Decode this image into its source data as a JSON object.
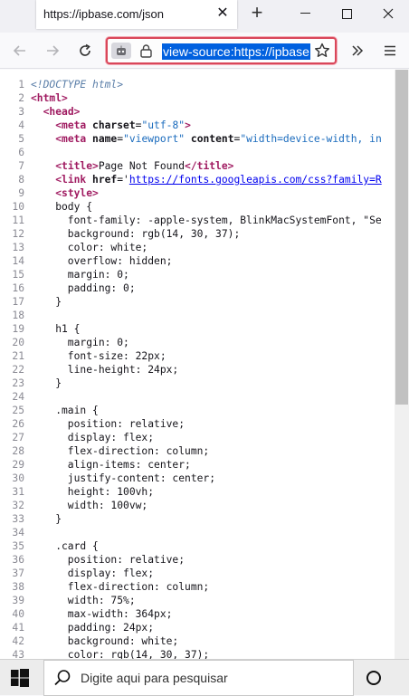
{
  "tab": {
    "title": "https://ipbase.com/json"
  },
  "urlbar": {
    "text": "view-source:https://ipbase."
  },
  "source_lines": [
    {
      "n": "1",
      "segs": [
        [
          "doctype",
          "<!DOCTYPE html>"
        ]
      ]
    },
    {
      "n": "2",
      "segs": [
        [
          "tag",
          "<html>"
        ]
      ]
    },
    {
      "n": "3",
      "segs": [
        [
          "code",
          "  "
        ],
        [
          "tag",
          "<head>"
        ]
      ]
    },
    {
      "n": "4",
      "segs": [
        [
          "code",
          "    "
        ],
        [
          "tag",
          "<meta "
        ],
        [
          "attr",
          "charset"
        ],
        [
          "code",
          "="
        ],
        [
          "val",
          "\"utf-8\""
        ],
        [
          "tag",
          ">"
        ]
      ]
    },
    {
      "n": "5",
      "segs": [
        [
          "code",
          "    "
        ],
        [
          "tag",
          "<meta "
        ],
        [
          "attr",
          "name"
        ],
        [
          "code",
          "="
        ],
        [
          "val",
          "\"viewport\""
        ],
        [
          "code",
          " "
        ],
        [
          "attr",
          "content"
        ],
        [
          "code",
          "="
        ],
        [
          "val",
          "\"width=device-width, in"
        ]
      ]
    },
    {
      "n": "6",
      "segs": []
    },
    {
      "n": "7",
      "segs": [
        [
          "code",
          "    "
        ],
        [
          "tag",
          "<title>"
        ],
        [
          "code",
          "Page Not Found"
        ],
        [
          "tag",
          "</title>"
        ]
      ]
    },
    {
      "n": "8",
      "segs": [
        [
          "code",
          "    "
        ],
        [
          "tag",
          "<link "
        ],
        [
          "attr",
          "href"
        ],
        [
          "code",
          "='"
        ],
        [
          "link",
          "https://fonts.googleapis.com/css?family=R"
        ]
      ]
    },
    {
      "n": "9",
      "segs": [
        [
          "code",
          "    "
        ],
        [
          "tag",
          "<style>"
        ]
      ]
    },
    {
      "n": "10",
      "segs": [
        [
          "code",
          "    body {"
        ]
      ]
    },
    {
      "n": "11",
      "segs": [
        [
          "code",
          "      font-family: -apple-system, BlinkMacSystemFont, \"Se"
        ]
      ]
    },
    {
      "n": "12",
      "segs": [
        [
          "code",
          "      background: rgb(14, 30, 37);"
        ]
      ]
    },
    {
      "n": "13",
      "segs": [
        [
          "code",
          "      color: white;"
        ]
      ]
    },
    {
      "n": "14",
      "segs": [
        [
          "code",
          "      overflow: hidden;"
        ]
      ]
    },
    {
      "n": "15",
      "segs": [
        [
          "code",
          "      margin: 0;"
        ]
      ]
    },
    {
      "n": "16",
      "segs": [
        [
          "code",
          "      padding: 0;"
        ]
      ]
    },
    {
      "n": "17",
      "segs": [
        [
          "code",
          "    }"
        ]
      ]
    },
    {
      "n": "18",
      "segs": []
    },
    {
      "n": "19",
      "segs": [
        [
          "code",
          "    h1 {"
        ]
      ]
    },
    {
      "n": "20",
      "segs": [
        [
          "code",
          "      margin: 0;"
        ]
      ]
    },
    {
      "n": "21",
      "segs": [
        [
          "code",
          "      font-size: 22px;"
        ]
      ]
    },
    {
      "n": "22",
      "segs": [
        [
          "code",
          "      line-height: 24px;"
        ]
      ]
    },
    {
      "n": "23",
      "segs": [
        [
          "code",
          "    }"
        ]
      ]
    },
    {
      "n": "24",
      "segs": []
    },
    {
      "n": "25",
      "segs": [
        [
          "code",
          "    .main {"
        ]
      ]
    },
    {
      "n": "26",
      "segs": [
        [
          "code",
          "      position: relative;"
        ]
      ]
    },
    {
      "n": "27",
      "segs": [
        [
          "code",
          "      display: flex;"
        ]
      ]
    },
    {
      "n": "28",
      "segs": [
        [
          "code",
          "      flex-direction: column;"
        ]
      ]
    },
    {
      "n": "29",
      "segs": [
        [
          "code",
          "      align-items: center;"
        ]
      ]
    },
    {
      "n": "30",
      "segs": [
        [
          "code",
          "      justify-content: center;"
        ]
      ]
    },
    {
      "n": "31",
      "segs": [
        [
          "code",
          "      height: 100vh;"
        ]
      ]
    },
    {
      "n": "32",
      "segs": [
        [
          "code",
          "      width: 100vw;"
        ]
      ]
    },
    {
      "n": "33",
      "segs": [
        [
          "code",
          "    }"
        ]
      ]
    },
    {
      "n": "34",
      "segs": []
    },
    {
      "n": "35",
      "segs": [
        [
          "code",
          "    .card {"
        ]
      ]
    },
    {
      "n": "36",
      "segs": [
        [
          "code",
          "      position: relative;"
        ]
      ]
    },
    {
      "n": "37",
      "segs": [
        [
          "code",
          "      display: flex;"
        ]
      ]
    },
    {
      "n": "38",
      "segs": [
        [
          "code",
          "      flex-direction: column;"
        ]
      ]
    },
    {
      "n": "39",
      "segs": [
        [
          "code",
          "      width: 75%;"
        ]
      ]
    },
    {
      "n": "40",
      "segs": [
        [
          "code",
          "      max-width: 364px;"
        ]
      ]
    },
    {
      "n": "41",
      "segs": [
        [
          "code",
          "      padding: 24px;"
        ]
      ]
    },
    {
      "n": "42",
      "segs": [
        [
          "code",
          "      background: white;"
        ]
      ]
    },
    {
      "n": "43",
      "segs": [
        [
          "code",
          "      color: rgb(14, 30, 37);"
        ]
      ]
    }
  ],
  "taskbar": {
    "search_placeholder": "Digite aqui para pesquisar"
  },
  "icons": {
    "back": "back-arrow-icon",
    "forward": "forward-arrow-icon",
    "reload": "reload-icon",
    "lock": "lock-icon",
    "robot": "remote-control-icon",
    "star": "bookmark-star-icon",
    "overflow": "chevron-double-right-icon",
    "menu": "hamburger-menu-icon",
    "windows": "windows-start-icon",
    "search": "search-icon",
    "cortana": "cortana-circle-icon"
  },
  "colors": {
    "url_highlight": "#0060df",
    "urlbar_border": "#d9475a",
    "tag": "#a01b61",
    "attr_value": "#1a6bbd"
  }
}
